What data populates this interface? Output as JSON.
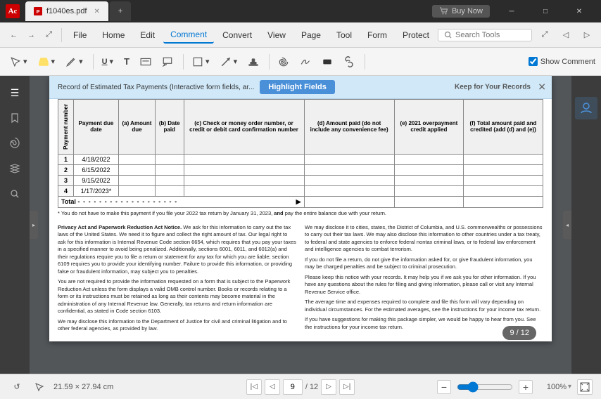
{
  "titlebar": {
    "logo": "Ac",
    "filename": "f1040es.pdf",
    "add_tab": "+",
    "buy_now": "Buy Now",
    "controls": [
      "—",
      "□",
      "✕"
    ]
  },
  "menubar": {
    "items": [
      "File",
      "Home",
      "Edit",
      "Comment",
      "Convert",
      "View",
      "Page",
      "Tool",
      "Form",
      "Protect"
    ],
    "active": "Comment",
    "search_placeholder": "Search Tools",
    "toolbar_buttons": [
      "←",
      "→",
      "⤢",
      "⤡"
    ]
  },
  "ribbon": {
    "show_comment_label": "Show Comment",
    "show_comment_checked": true,
    "groups": [
      {
        "buttons": [
          "✏",
          "▾",
          "🖊",
          "▾",
          "✏",
          "▾",
          "◻",
          "▾",
          "T",
          "T⌯",
          "⊞",
          "⊡",
          "⬡",
          "▾",
          "◷",
          "▾",
          "⊕",
          "▾",
          "✂",
          "▾",
          "👥",
          "▾",
          "⭐",
          "🔗",
          "📋",
          "▾"
        ]
      }
    ]
  },
  "banner": {
    "text": "Record of Estimated Tax Payments (Interactive form fields, ar...",
    "highlight_btn": "Highlight Fields",
    "keep_record": "Keep for Your Records",
    "close": "✕"
  },
  "table": {
    "headers": [
      "Payment number",
      "Payment due date",
      "(a) Amount due",
      "(b) Date paid",
      "(c) Check or money order number, or credit or debit card confirmation number",
      "(d) Amount paid (do not include any convenience fee)",
      "(e) 2021 overpayment credit applied",
      "(f) Total amount paid and credited (add (d) and (e))"
    ],
    "rows": [
      {
        "num": "1",
        "date": "4/18/2022",
        "a": "",
        "b": "",
        "c": "",
        "d": "",
        "e": "",
        "f": ""
      },
      {
        "num": "2",
        "date": "6/15/2022",
        "a": "",
        "b": "",
        "c": "",
        "d": "",
        "e": "",
        "f": ""
      },
      {
        "num": "3",
        "date": "9/15/2022",
        "a": "",
        "b": "",
        "c": "",
        "d": "",
        "e": "",
        "f": ""
      },
      {
        "num": "4",
        "date": "1/17/2023*",
        "a": "",
        "b": "",
        "c": "",
        "d": "",
        "e": "",
        "f": ""
      }
    ],
    "total_label": "Total",
    "footnote": "* You do not have to make this payment if you file your 2022 tax return by January 31, 2023, and pay the entire balance due with your return."
  },
  "legal": {
    "title": "Privacy Act and Paperwork Reduction Act Notice.",
    "col1_text": "We ask for this information to carry out the tax laws of the United States. We need it to figure and collect the right amount of tax. Our legal right to ask for this information is Internal Revenue Code section 6654, which requires that you pay your taxes in a specified manner to avoid being penalized. Additionally, sections 6001, 6011, and 6012(a) and their regulations require you to file a return or statement for any tax for which you are liable; section 6109 requires you to provide your identifying number. Failure to provide this information, or providing false or fraudulent information, may subject you to penalties.\n\nYou are not required to provide the information requested on a form that is subject to the Paperwork Reduction Act unless the form displays a valid OMB control number. Books or records relating to a form or its instructions must be retained as long as their contents may become material in the administration of any Internal Revenue law. Generally, tax returns and return information are confidential, as stated in Code section 6103.\n\nWe may disclose this information to the Department of Justice for civil and criminal litigation and to other federal agencies, as provided by law.",
    "col2_text": "We may disclose it to cities, states, the District of Columbia, and U.S. commonwealths or possessions to carry out their tax laws. We may also disclose this information to other countries under a tax treaty, to federal and state agencies to enforce federal nontax criminal laws, or to federal law enforcement and intelligence agencies to combat terrorism.\n\nIf you do not file a return, do not give the information asked for, or give fraudulent information, you may be charged penalties and be subject to criminal prosecution.\n\nPlease keep this notice with your records. It may help you if we ask you for other information. If you have any questions about the rules for filing and giving information, please call or visit any Internal Revenue Service office.\n\nThe average time and expenses required to complete and file this form will vary depending on individual circumstances. For the estimated averages, see the instructions for your income tax return.\n\nIf you have suggestions for making this package simpler, we would be happy to hear from you. See the instructions for your income tax return."
  },
  "statusbar": {
    "dimensions": "21.59 × 27.94 cm",
    "current_page": "9",
    "total_pages": "12",
    "page_display": "9 / 12",
    "zoom_level": "100%",
    "zoom_value": 100
  },
  "sidebar": {
    "icons": [
      "☰",
      "🔖",
      "📎",
      "🔍",
      "💬"
    ]
  }
}
